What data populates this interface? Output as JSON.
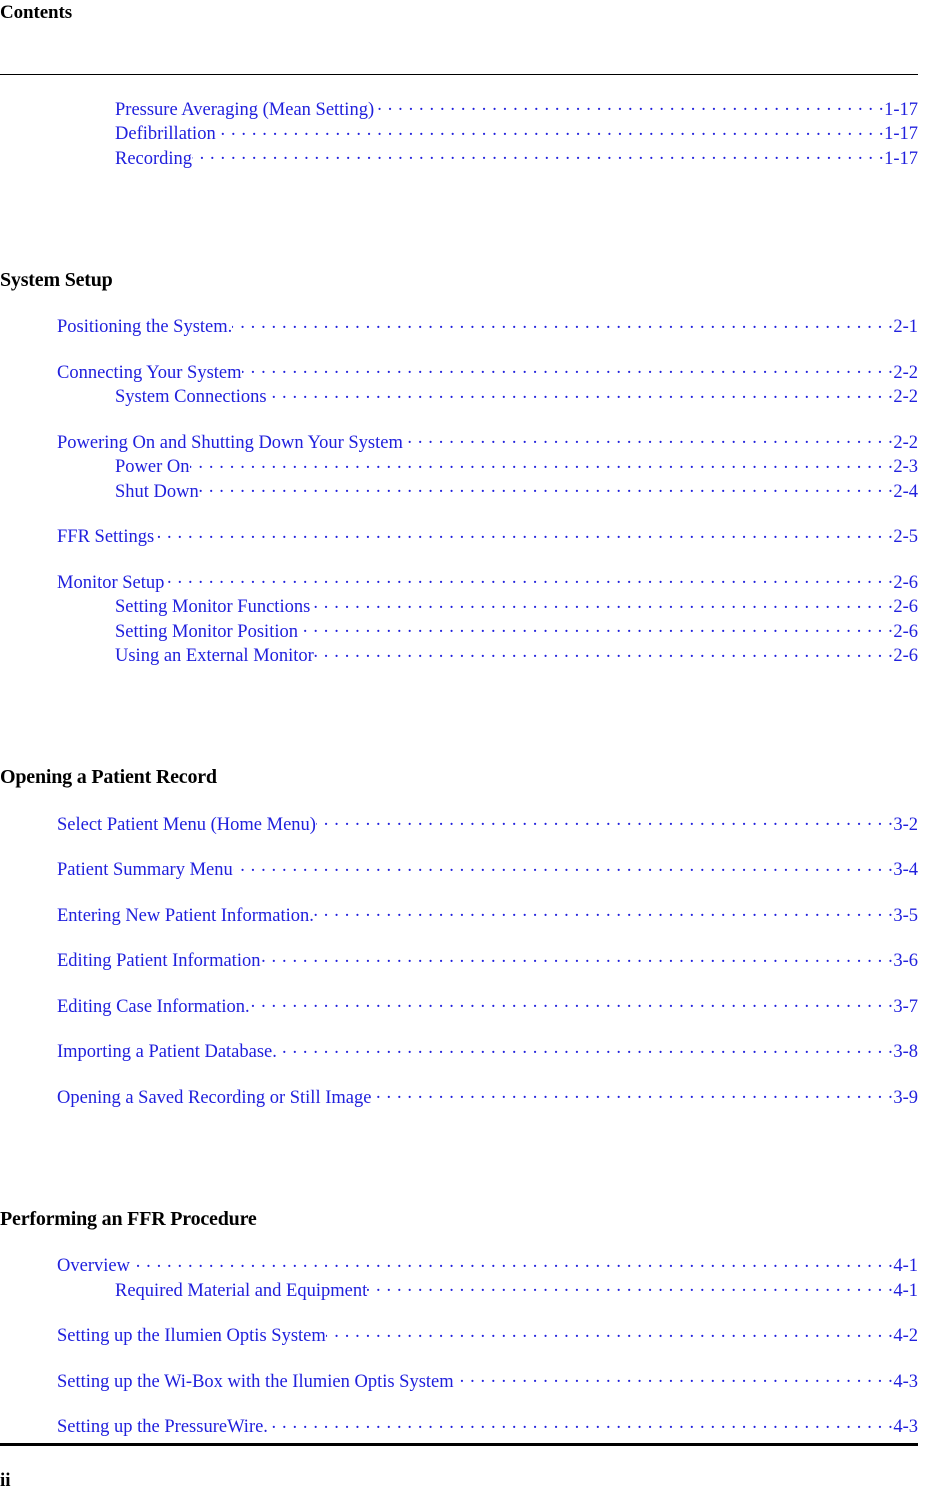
{
  "header": {
    "title": "Contents"
  },
  "footer": {
    "page_number": "ii"
  },
  "colors": {
    "link_blue": "#2020dd",
    "text_black": "#000000",
    "page_background": "#ffffff"
  },
  "toc": {
    "groups": [
      {
        "heading": null,
        "entries": [
          {
            "level": 2,
            "label": "Pressure Averaging (Mean Setting)",
            "page": "1-17"
          },
          {
            "level": 2,
            "label": "Defibrillation ",
            "page": "1-17"
          },
          {
            "level": 2,
            "label": "Recording",
            "page": "1-17"
          }
        ]
      },
      {
        "heading": "System Setup",
        "entries": [
          {
            "level": 1,
            "label": "Positioning the System.",
            "page": "2-1"
          },
          {
            "level": 1,
            "label": "Connecting Your System",
            "page": "2-2"
          },
          {
            "level": 2,
            "label": "System Connections",
            "page": "2-2"
          },
          {
            "level": 1,
            "label": "Powering On and Shutting Down Your System ",
            "page": "2-2"
          },
          {
            "level": 2,
            "label": "Power On ",
            "page": "2-3"
          },
          {
            "level": 2,
            "label": "Shut Down ",
            "page": "2-4"
          },
          {
            "level": 1,
            "label": "FFR Settings ",
            "page": "2-5"
          },
          {
            "level": 1,
            "label": "Monitor Setup ",
            "page": "2-6"
          },
          {
            "level": 2,
            "label": "Setting Monitor Functions ",
            "page": "2-6"
          },
          {
            "level": 2,
            "label": "Setting Monitor Position ",
            "page": "2-6"
          },
          {
            "level": 2,
            "label": "Using an External Monitor",
            "page": "2-6"
          }
        ]
      },
      {
        "heading": "Opening a Patient Record",
        "entries": [
          {
            "level": 1,
            "label": "Select Patient Menu (Home Menu) ",
            "page": "3-2"
          },
          {
            "level": 1,
            "label": "Patient Summary Menu ",
            "page": "3-4"
          },
          {
            "level": 1,
            "label": "Entering New Patient Information.",
            "page": "3-5"
          },
          {
            "level": 1,
            "label": "Editing Patient Information ",
            "page": "3-6"
          },
          {
            "level": 1,
            "label": "Editing Case Information.",
            "page": "3-7"
          },
          {
            "level": 1,
            "label": "Importing a Patient Database.",
            "page": "3-8"
          },
          {
            "level": 1,
            "label": "Opening a Saved Recording or Still Image ",
            "page": "3-9"
          }
        ]
      },
      {
        "heading": "Performing an FFR Procedure",
        "entries": [
          {
            "level": 1,
            "label": "Overview ",
            "page": "4-1"
          },
          {
            "level": 2,
            "label": "Required Material and Equipment ",
            "page": "4-1"
          },
          {
            "level": 1,
            "label": "Setting up the Ilumien Optis System ",
            "page": "4-2"
          },
          {
            "level": 1,
            "label": "Setting up the Wi-Box with the Ilumien Optis System ",
            "page": "4-3"
          },
          {
            "level": 1,
            "label": "Setting up the PressureWire.",
            "page": "4-3"
          }
        ]
      }
    ]
  }
}
